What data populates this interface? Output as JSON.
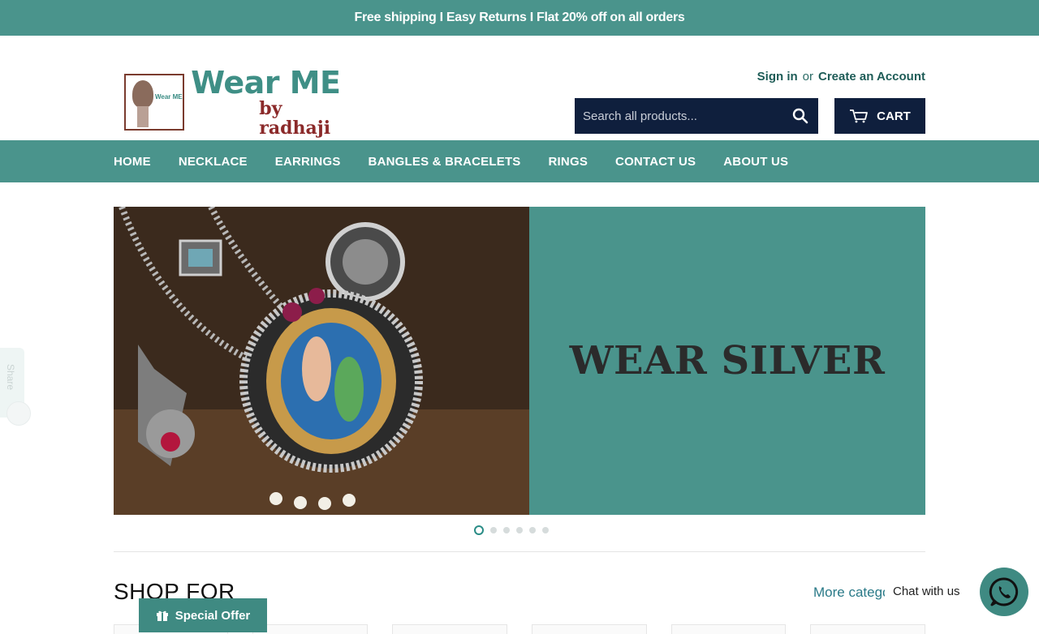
{
  "announcement": "Free shipping I Easy Returns I Flat 20% off on all orders",
  "brand": {
    "title": "Wear ME",
    "subtitle": "by radhaji",
    "emblem_text": "Wear ME"
  },
  "account": {
    "signin": "Sign in",
    "or": "or",
    "create": "Create an Account"
  },
  "search": {
    "placeholder": "Search all products..."
  },
  "cart": {
    "label": "CART"
  },
  "nav": {
    "items": [
      {
        "label": "HOME"
      },
      {
        "label": "NECKLACE"
      },
      {
        "label": "EARRINGS"
      },
      {
        "label": "BANGLES & BRACELETS"
      },
      {
        "label": "RINGS"
      },
      {
        "label": "CONTACT US"
      },
      {
        "label": "ABOUT US"
      }
    ]
  },
  "hero": {
    "title": "WEAR SILVER",
    "slide_count": 6,
    "active_slide": 1
  },
  "section": {
    "title": "SHOP FOR",
    "more_link": "More categories"
  },
  "chat": {
    "label": "Chat with us"
  },
  "offer": {
    "label": "Special Offer"
  },
  "share": {
    "label": "Share"
  },
  "colors": {
    "teal": "#4a948c",
    "navy": "#0f1f3d",
    "heading": "#2b2b2b"
  }
}
